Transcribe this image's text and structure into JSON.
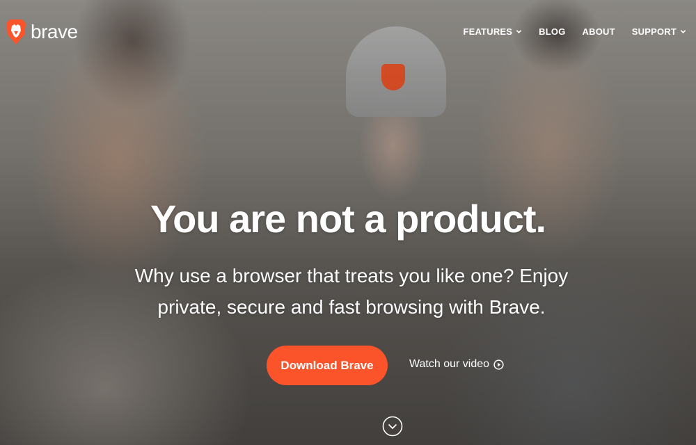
{
  "header": {
    "logo_text": "brave",
    "nav": [
      {
        "label": "FEATURES",
        "dropdown": true
      },
      {
        "label": "BLOG",
        "dropdown": false
      },
      {
        "label": "ABOUT",
        "dropdown": false
      },
      {
        "label": "SUPPORT",
        "dropdown": true
      }
    ]
  },
  "hero": {
    "headline": "You are not a product.",
    "subheadline_line1": "Why use a browser that treats you like one? Enjoy",
    "subheadline_line2": "private, secure and fast browsing with Brave.",
    "cta_label": "Download Brave",
    "video_link_label": "Watch our video"
  },
  "icons": {
    "logo": "brave-lion-icon",
    "dropdown": "chevron-down-icon",
    "play": "play-circle-icon",
    "scroll": "chevron-down-circle-icon"
  },
  "colors": {
    "accent": "#fb542b",
    "text": "#ffffff"
  }
}
